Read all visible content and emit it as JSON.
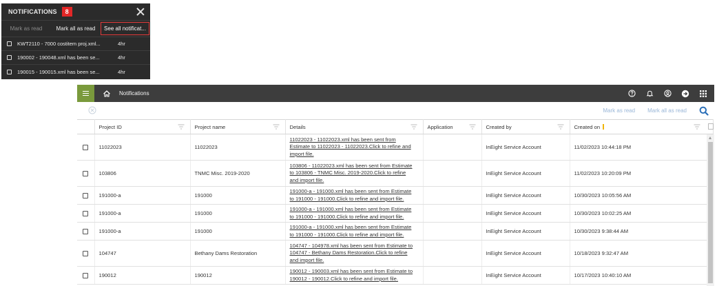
{
  "popup": {
    "title": "NOTIFICATIONS",
    "count": "8",
    "actions": {
      "mark_as_read": "Mark as read",
      "mark_all_as_read": "Mark all as read",
      "see_all": "See all notificat..."
    },
    "items": [
      {
        "text": "KWT2110 - 7000 costitem proj.xml...",
        "time": "4hr"
      },
      {
        "text": "190002 - 190048.xml has been se...",
        "time": "4hr"
      },
      {
        "text": "190015 - 190015.xml has been se...",
        "time": "4hr"
      }
    ]
  },
  "topbar": {
    "title": "Notifications",
    "icons": [
      "help-icon",
      "bell-icon",
      "account-icon",
      "app-switch-icon",
      "grid-apps-icon"
    ]
  },
  "toolbar": {
    "mark_as_read": "Mark as read",
    "mark_all_as_read": "Mark all as read"
  },
  "table": {
    "columns": {
      "project_id": "Project ID",
      "project_name": "Project name",
      "details": "Details",
      "application": "Application",
      "created_by": "Created by",
      "created_on": "Created on"
    },
    "rows": [
      {
        "project_id": "11022023",
        "project_name": "11022023",
        "details": [
          "11022023 - 11022023.xml has been sent from",
          "Estimate to 11022023 - 11022023.Click to refine and",
          "import file."
        ],
        "application": "",
        "created_by": "InEight Service Account",
        "created_on": "11/02/2023 10:44:18 PM"
      },
      {
        "project_id": "103806",
        "project_name": "TNMC Misc. 2019-2020",
        "details": [
          "103806 - 11022023.xml has been sent from Estimate",
          "to 103806 - TNMC Misc. 2019-2020.Click to refine",
          "and import file."
        ],
        "application": "",
        "created_by": "InEight Service Account",
        "created_on": "11/02/2023 10:20:09 PM"
      },
      {
        "project_id": "191000-a",
        "project_name": "191000",
        "details": [
          "191000-a - 191000.xml has been sent from Estimate",
          "to 191000 - 191000.Click to refine and import file."
        ],
        "application": "",
        "created_by": "InEight Service Account",
        "created_on": "10/30/2023 10:05:56 AM"
      },
      {
        "project_id": "191000-a",
        "project_name": "191000",
        "details": [
          "191000-a - 191000.xml has been sent from Estimate",
          "to 191000 - 191000.Click to refine and import file."
        ],
        "application": "",
        "created_by": "InEight Service Account",
        "created_on": "10/30/2023 10:02:25 AM"
      },
      {
        "project_id": "191000-a",
        "project_name": "191000",
        "details": [
          "191000-a - 191000.xml has been sent from Estimate",
          "to 191000 - 191000.Click to refine and import file."
        ],
        "application": "",
        "created_by": "InEight Service Account",
        "created_on": "10/30/2023 9:38:44 AM"
      },
      {
        "project_id": "104747",
        "project_name": "Bethany Dams Restoration",
        "details": [
          "104747 - 104978.xml has been sent from Estimate to",
          "104747 - Bethany Dams Restoration.Click to refine",
          "and import file."
        ],
        "application": "",
        "created_by": "InEight Service Account",
        "created_on": "10/18/2023 9:32:47 AM"
      },
      {
        "project_id": "190012",
        "project_name": "190012",
        "details": [
          "190012 - 190003.xml has been sent from Estimate to",
          "190012 - 190012.Click to refine and import file."
        ],
        "application": "",
        "created_by": "InEight Service Account",
        "created_on": "10/17/2023 10:40:10 AM"
      }
    ]
  },
  "colors": {
    "menu_green": "#7a9a3c",
    "topbar": "#3d3d3d",
    "popup_bg": "#2b2b2b",
    "badge_red": "#e32727",
    "link_blue": "#9ab7d8",
    "search_blue": "#2a6fb8",
    "sort_yellow": "#f0b400"
  }
}
